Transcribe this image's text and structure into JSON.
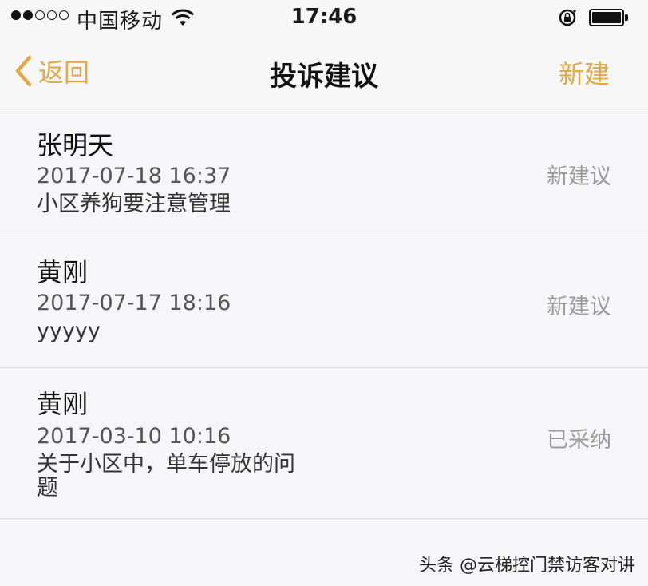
{
  "status_bar": {
    "signal_dots": [
      true,
      true,
      false,
      false,
      false
    ],
    "carrier": "中国移动",
    "time": "17:46"
  },
  "nav": {
    "back_label": "返回",
    "title": "投诉建议",
    "new_label": "新建",
    "accent_color": "#e0a94a"
  },
  "items": [
    {
      "name": "张明天",
      "date": "2017-07-18 16:37",
      "content": "小区养狗要注意管理",
      "status": "新建议"
    },
    {
      "name": "黄刚",
      "date": "2017-07-17 18:16",
      "content": "yyyyy",
      "status": "新建议"
    },
    {
      "name": "黄刚",
      "date": "2017-03-10 10:16",
      "content": "关于小区中，单车停放的问题",
      "status": "已采纳"
    }
  ],
  "watermark": "头条 @云梯控门禁访客对讲"
}
